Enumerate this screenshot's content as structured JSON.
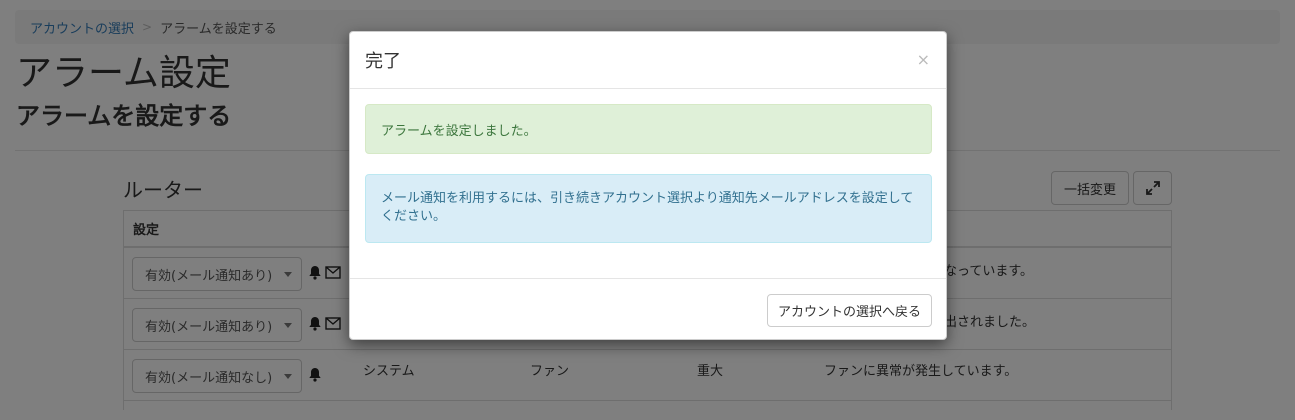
{
  "breadcrumb": {
    "link": "アカウントの選択",
    "separator": ">",
    "current": "アラームを設定する"
  },
  "page": {
    "title": "アラーム設定",
    "subtitle": "アラームを設定する"
  },
  "section": {
    "title": "ルーター",
    "bulk_label": "一括変更",
    "expand_icon": "expand-icon"
  },
  "table": {
    "header": "設定",
    "rows": [
      {
        "setting": "有効(メール通知あり)",
        "icons": [
          "bell-icon",
          "envelope-icon"
        ],
        "col2": "",
        "col3": "",
        "col4": "",
        "message": "なっています。"
      },
      {
        "setting": "有効(メール通知あり)",
        "icons": [
          "bell-icon",
          "envelope-icon"
        ],
        "col2": "",
        "col3": "",
        "col4": "",
        "message": "出されました。"
      },
      {
        "setting": "有効(メール通知なし)",
        "icons": [
          "bell-icon"
        ],
        "col2": "システム",
        "col3": "ファン",
        "col4": "重大",
        "message": "ファンに異常が発生しています。"
      }
    ]
  },
  "modal": {
    "title": "完了",
    "close": "×",
    "success_text": "アラームを設定しました。",
    "info_text": "メール通知を利用するには、引き続きアカウント選択より通知先メールアドレスを設定してください。",
    "back_label": "アカウントの選択へ戻る"
  },
  "colors": {
    "success_bg": "#dff0d8",
    "info_bg": "#d9edf7",
    "link": "#337ab7"
  }
}
